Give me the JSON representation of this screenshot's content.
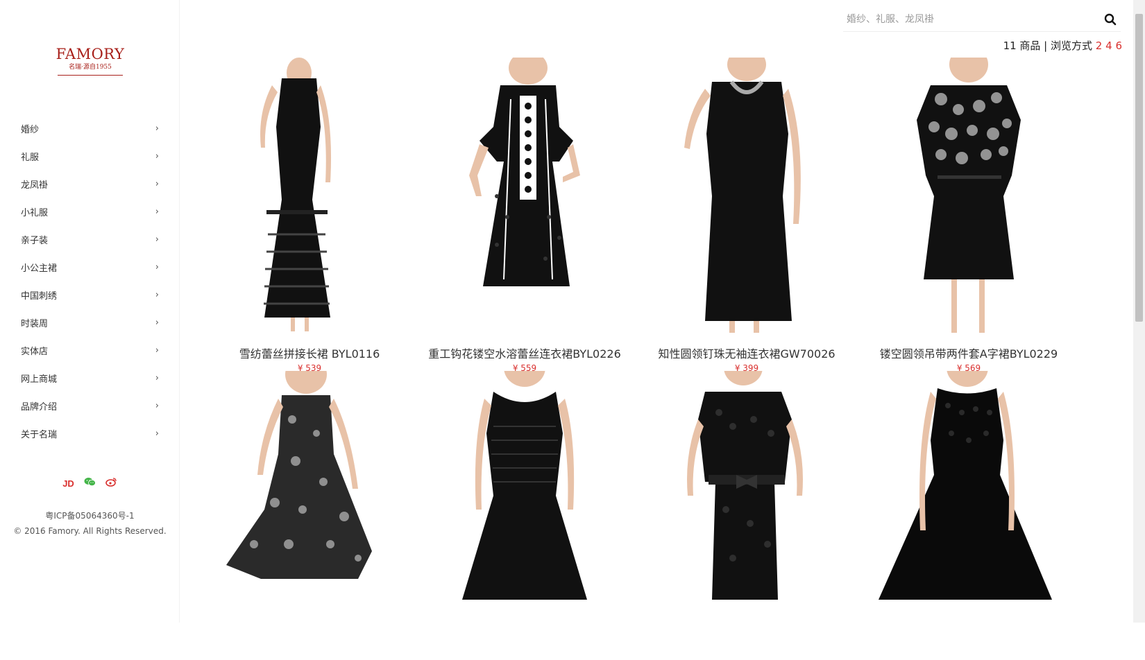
{
  "logo": {
    "name": "FAMORY",
    "tagline": "名瑞·源自1955"
  },
  "menu": [
    {
      "label": "婚纱"
    },
    {
      "label": "礼服"
    },
    {
      "label": "龙凤褂"
    },
    {
      "label": "小礼服"
    },
    {
      "label": "亲子装"
    },
    {
      "label": "小公主裙"
    },
    {
      "label": "中国刺绣"
    },
    {
      "label": "时装周"
    },
    {
      "label": "实体店"
    },
    {
      "label": "网上商城"
    },
    {
      "label": "品牌介绍"
    },
    {
      "label": "关于名瑞"
    }
  ],
  "social": {
    "jd": "JD",
    "icons": [
      "wechat-icon",
      "weibo-icon"
    ]
  },
  "footer": {
    "icp": "粤ICP备05064360号-1",
    "copyright": "© 2016 Famory. All Rights Reserved."
  },
  "search": {
    "placeholder": "婚纱、礼服、龙凤褂",
    "icon": "search-icon"
  },
  "browse": {
    "count_text": "11 商品 | 浏览方式",
    "options": [
      "2",
      "4",
      "6"
    ]
  },
  "products": [
    {
      "name": "雪纺蕾丝拼接长裙 BYL0116",
      "price": "¥ 539"
    },
    {
      "name": "重工钩花镂空水溶蕾丝连衣裙BYL0226",
      "price": "¥ 559"
    },
    {
      "name": "知性圆领钉珠无袖连衣裙GW70026",
      "price": "¥ 399"
    },
    {
      "name": "镂空圆领吊带两件套A字裙BYL0229",
      "price": "¥ 569"
    },
    {
      "name": "",
      "price": ""
    },
    {
      "name": "",
      "price": ""
    },
    {
      "name": "",
      "price": ""
    },
    {
      "name": "",
      "price": ""
    }
  ],
  "colors": {
    "accent": "#d9302e",
    "brand": "#a8201a"
  }
}
